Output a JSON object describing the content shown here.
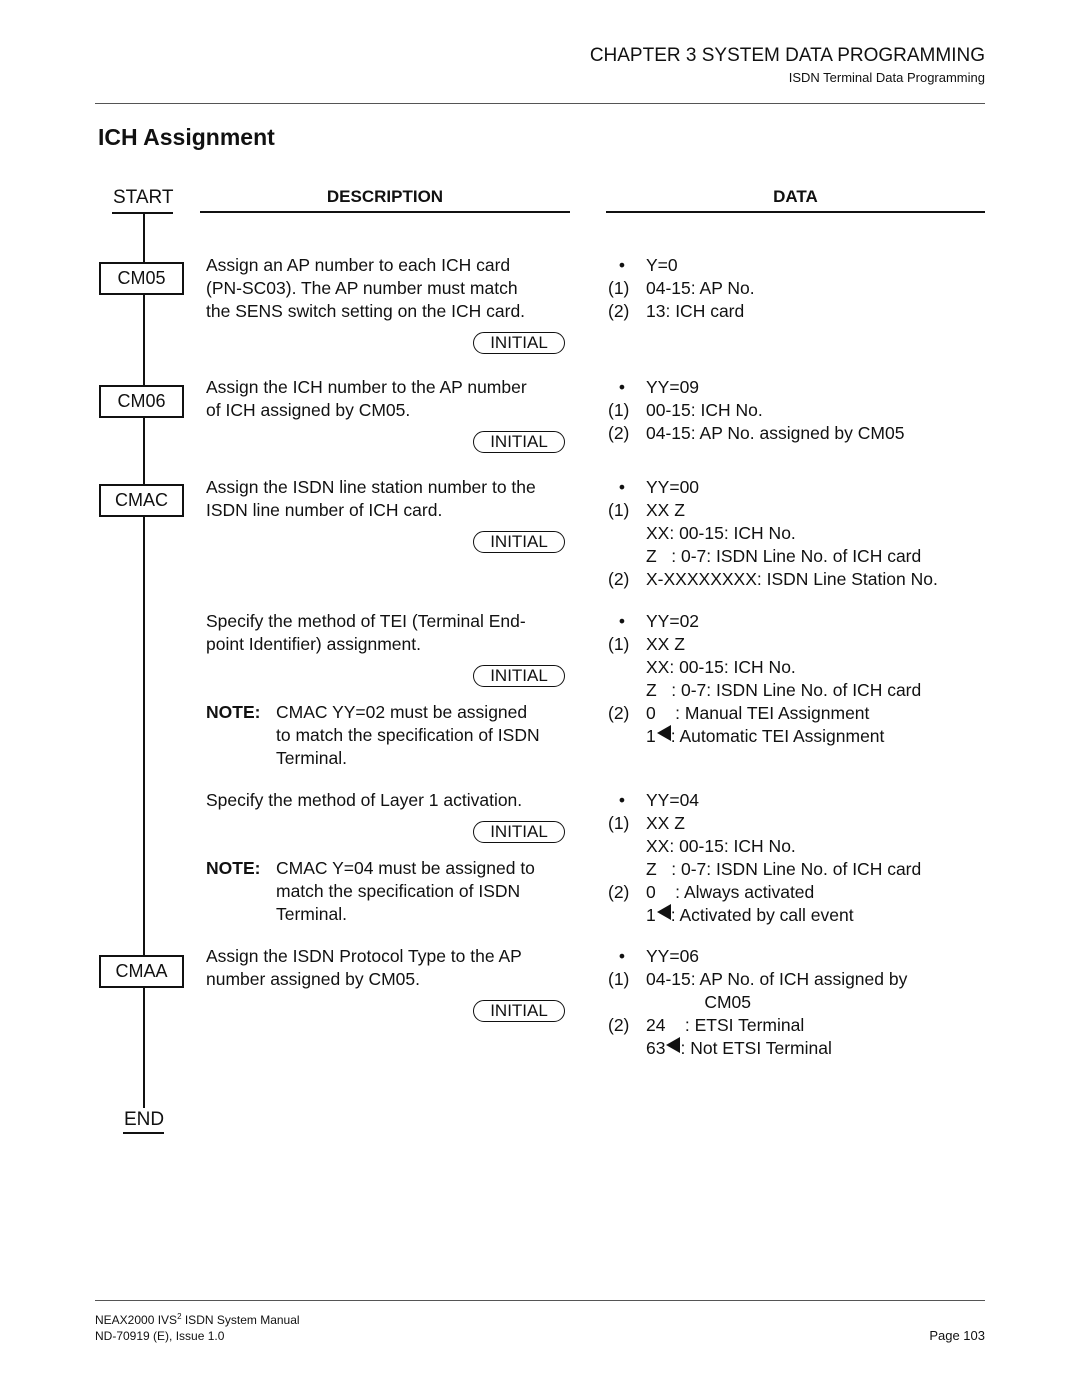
{
  "header": {
    "chapter": "CHAPTER 3  SYSTEM DATA PROGRAMMING",
    "section": "ISDN Terminal Data Programming"
  },
  "title": "ICH Assignment",
  "flow": {
    "start": "START",
    "end": "END",
    "columns": {
      "description": "DESCRIPTION",
      "data": "DATA"
    },
    "commands": [
      "CM05",
      "CM06",
      "CMAC",
      "CMAA"
    ]
  },
  "initial_label": "INITIAL",
  "steps": [
    {
      "command": "CM05",
      "description": [
        "Assign an AP number to each ICH card",
        "(PN-SC03). The AP number must match",
        "the SENS switch setting on the ICH card."
      ],
      "data": [
        {
          "marker": "•",
          "text": "Y=0"
        },
        {
          "marker": "(1)",
          "text": "04-15: AP No."
        },
        {
          "marker": "(2)",
          "text": "13: ICH card"
        }
      ]
    },
    {
      "command": "CM06",
      "description": [
        "Assign the ICH number to the AP number",
        "of ICH assigned by CM05."
      ],
      "data": [
        {
          "marker": "•",
          "text": "YY=09"
        },
        {
          "marker": "(1)",
          "text": "00-15: ICH No."
        },
        {
          "marker": "(2)",
          "text": "04-15: AP No. assigned by CM05"
        }
      ]
    },
    {
      "command": "CMAC",
      "description": [
        "Assign the ISDN line station number to the",
        "ISDN line number of ICH card."
      ],
      "data": [
        {
          "marker": "•",
          "text": "YY=00"
        },
        {
          "marker": "(1)",
          "text": "XX Z"
        },
        {
          "marker": "",
          "text": "XX: 00-15: ICH No."
        },
        {
          "marker": "",
          "text": "Z   : 0-7: ISDN Line No. of ICH card"
        },
        {
          "marker": "(2)",
          "text": "X-XXXXXXXX: ISDN Line Station No."
        }
      ]
    },
    {
      "command": "",
      "description": [
        "Specify the method of TEI (Terminal End-",
        "point Identifier) assignment."
      ],
      "note_label": "NOTE:",
      "note": [
        "CMAC YY=02 must be assigned",
        "to match the specification of ISDN",
        "Terminal."
      ],
      "data": [
        {
          "marker": "•",
          "text": "YY=02"
        },
        {
          "marker": "(1)",
          "text": "XX Z"
        },
        {
          "marker": "",
          "text": "XX: 00-15: ICH No."
        },
        {
          "marker": "",
          "text": "Z   : 0-7: ISDN Line No. of ICH card"
        },
        {
          "marker": "(2)",
          "text": "0    : Manual TEI Assignment"
        },
        {
          "marker": "",
          "value": "1",
          "default": true,
          "text": ": Automatic TEI Assignment"
        }
      ]
    },
    {
      "command": "",
      "description": [
        "Specify the method of Layer 1 activation."
      ],
      "note_label": "NOTE:",
      "note": [
        "CMAC Y=04 must be assigned to",
        "match the specification of ISDN",
        "Terminal."
      ],
      "data": [
        {
          "marker": "•",
          "text": "YY=04"
        },
        {
          "marker": "(1)",
          "text": "XX Z"
        },
        {
          "marker": "",
          "text": "XX: 00-15: ICH No."
        },
        {
          "marker": "",
          "text": "Z   : 0-7: ISDN Line No. of ICH card"
        },
        {
          "marker": "(2)",
          "text": "0    : Always activated"
        },
        {
          "marker": "",
          "value": "1",
          "default": true,
          "text": ": Activated by call event"
        }
      ]
    },
    {
      "command": "CMAA",
      "description": [
        "Assign the ISDN Protocol Type to the AP",
        "number assigned by CM05."
      ],
      "data": [
        {
          "marker": "•",
          "text": "YY=06"
        },
        {
          "marker": "(1)",
          "text": "04-15: AP No. of ICH assigned by"
        },
        {
          "marker": "",
          "text": "            CM05"
        },
        {
          "marker": "(2)",
          "text": "24    : ETSI Terminal"
        },
        {
          "marker": "",
          "value": "63",
          "default": true,
          "text": ": Not ETSI Terminal"
        }
      ]
    }
  ],
  "footer": {
    "manual_prefix": "NEAX2000 IVS",
    "manual_sup": "2",
    "manual_suffix": " ISDN System Manual",
    "doc_id": "ND-70919 (E), Issue 1.0",
    "page": "Page 103"
  }
}
